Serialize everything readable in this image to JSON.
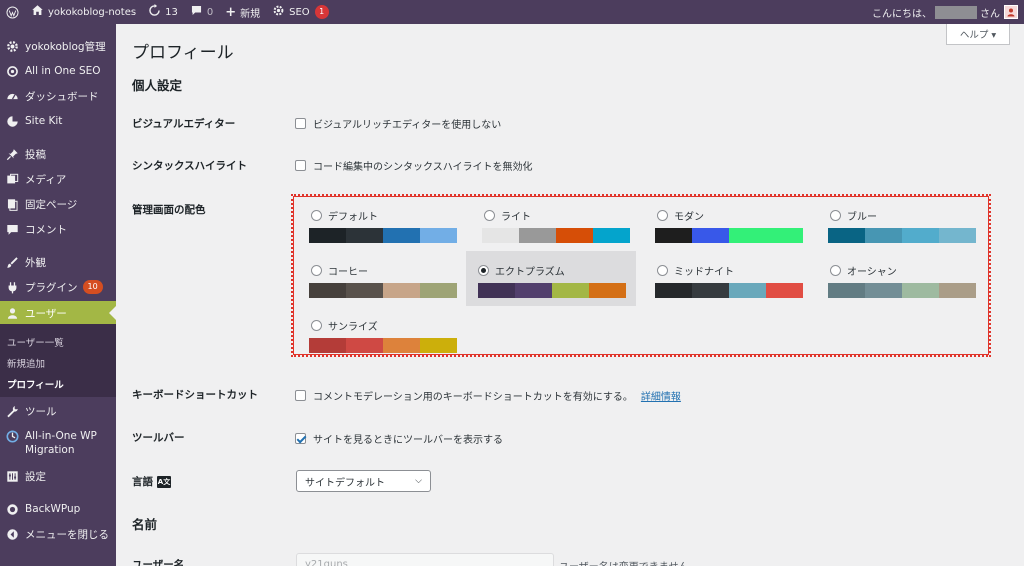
{
  "adminbar": {
    "site_name": "yokokoblog-notes",
    "updates_count": "13",
    "comments_count": "0",
    "new_label": "新規",
    "seo_label": "SEO",
    "seo_badge": "1",
    "greeting": "こんにちは、",
    "greeting_suffix": "さん"
  },
  "sidebar": {
    "items": [
      {
        "label": "yokokoblog管理",
        "icon": "gear-icon"
      },
      {
        "label": "All in One SEO",
        "icon": "seo-icon"
      },
      {
        "label": "ダッシュボード",
        "icon": "dashboard-icon"
      },
      {
        "label": "Site Kit",
        "icon": "sitekit-icon"
      },
      {
        "label": "投稿",
        "icon": "pin-icon"
      },
      {
        "label": "メディア",
        "icon": "media-icon"
      },
      {
        "label": "固定ページ",
        "icon": "page-icon"
      },
      {
        "label": "コメント",
        "icon": "comment-icon"
      },
      {
        "label": "外観",
        "icon": "brush-icon"
      },
      {
        "label": "プラグイン",
        "icon": "plugin-icon",
        "badge": "10"
      },
      {
        "label": "ユーザー",
        "icon": "user-icon"
      },
      {
        "label": "ツール",
        "icon": "wrench-icon"
      },
      {
        "label": "All-in-One WP Migration",
        "icon": "migration-icon"
      },
      {
        "label": "設定",
        "icon": "settings-icon"
      },
      {
        "label": "BackWPup",
        "icon": "backwpup-icon"
      },
      {
        "label": "メニューを閉じる",
        "icon": "collapse-icon"
      }
    ],
    "users_submenu": [
      "ユーザー一覧",
      "新規追加",
      "プロフィール"
    ]
  },
  "main": {
    "help_label": "ヘルプ ▾",
    "page_title": "プロフィール",
    "personal_settings_title": "個人設定",
    "visual_editor": {
      "label": "ビジュアルエディター",
      "option": "ビジュアルリッチエディターを使用しない",
      "checked": false
    },
    "syntax_highlight": {
      "label": "シンタックスハイライト",
      "option": "コード編集中のシンタックスハイライトを無効化",
      "checked": false
    },
    "admin_color": {
      "label": "管理画面の配色",
      "selected": "エクトプラズム",
      "schemes": [
        {
          "name": "デフォルト",
          "colors": [
            "#1d2327",
            "#2c3338",
            "#2271b1",
            "#72aee6"
          ]
        },
        {
          "name": "ライト",
          "colors": [
            "#e5e5e5",
            "#999999",
            "#d64e07",
            "#04a4cc"
          ]
        },
        {
          "name": "モダン",
          "colors": [
            "#1e1e1e",
            "#3858e9",
            "#33f078",
            "#33f078"
          ]
        },
        {
          "name": "ブルー",
          "colors": [
            "#096484",
            "#4796b3",
            "#52accc",
            "#74b6ce"
          ]
        },
        {
          "name": "コーヒー",
          "colors": [
            "#46403c",
            "#59524c",
            "#c7a589",
            "#9ea476"
          ]
        },
        {
          "name": "エクトプラズム",
          "colors": [
            "#413256",
            "#523f6d",
            "#a3b745",
            "#d46f15"
          ]
        },
        {
          "name": "ミッドナイト",
          "colors": [
            "#25282b",
            "#363b3f",
            "#69a8bb",
            "#e14d43"
          ]
        },
        {
          "name": "オーシャン",
          "colors": [
            "#627c83",
            "#738e96",
            "#9ebaa0",
            "#aa9d88"
          ]
        },
        {
          "name": "サンライズ",
          "colors": [
            "#b43c38",
            "#cf4944",
            "#dd823b",
            "#ccaf0b"
          ]
        }
      ]
    },
    "keyboard_shortcuts": {
      "label": "キーボードショートカット",
      "option": "コメントモデレーション用のキーボードショートカットを有効にする。",
      "link": "詳細情報",
      "checked": false
    },
    "toolbar": {
      "label": "ツールバー",
      "option": "サイトを見るときにツールバーを表示する",
      "checked": true
    },
    "language": {
      "label": "言語",
      "value": "サイトデフォルト"
    },
    "name_title": "名前",
    "username": {
      "label": "ユーザー名",
      "value": "y21guns",
      "note": "ユーザー名は変更できません。"
    }
  }
}
